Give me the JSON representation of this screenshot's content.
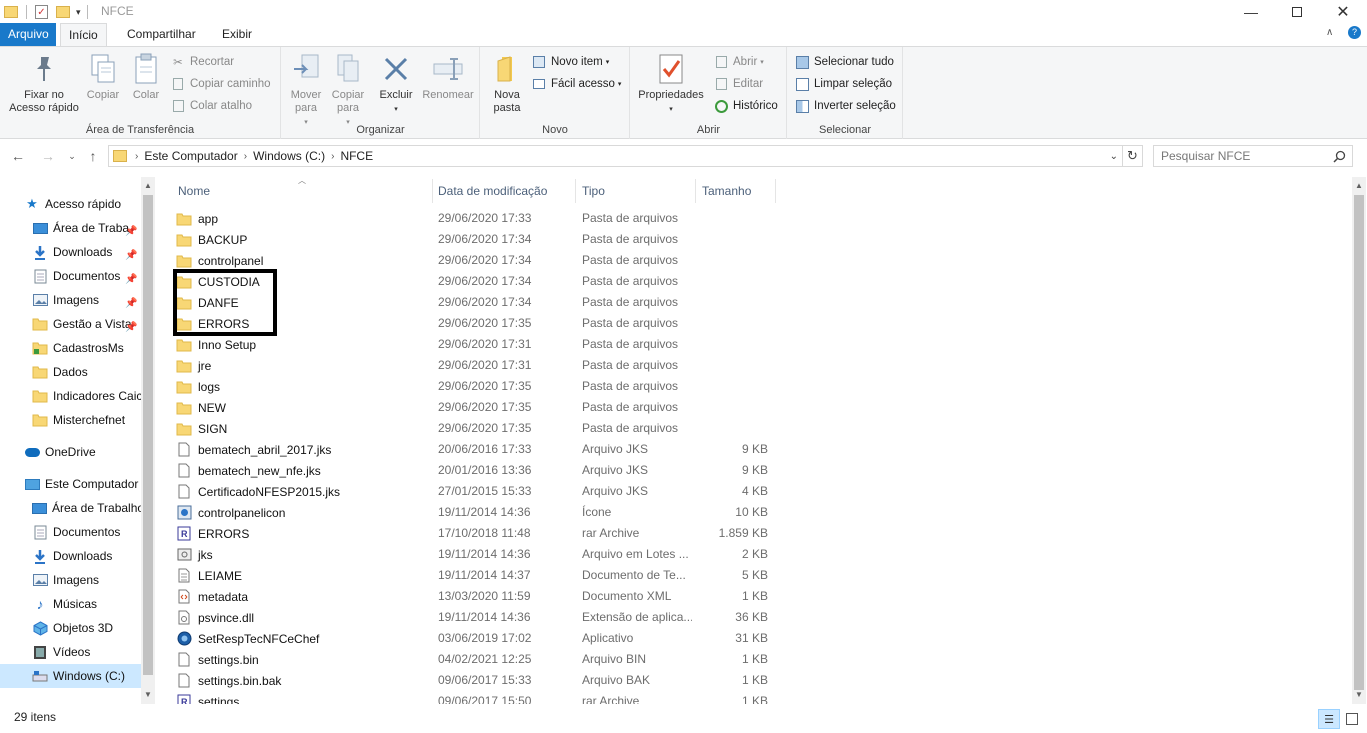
{
  "window": {
    "title": "NFCE"
  },
  "tabs": {
    "file": "Arquivo",
    "home": "Início",
    "share": "Compartilhar",
    "view": "Exibir"
  },
  "ribbon": {
    "clipboard": {
      "pin": "Fixar no Acesso rápido",
      "copy": "Copiar",
      "paste": "Colar",
      "cut": "Recortar",
      "copy_path": "Copiar caminho",
      "paste_shortcut": "Colar atalho",
      "label": "Área de Transferência"
    },
    "organize": {
      "move_to": "Mover para",
      "copy_to": "Copiar para",
      "delete": "Excluir",
      "rename": "Renomear",
      "label": "Organizar"
    },
    "new": {
      "new_folder": "Nova pasta",
      "new_item": "Novo item",
      "easy_access": "Fácil acesso",
      "label": "Novo"
    },
    "open": {
      "properties": "Propriedades",
      "open": "Abrir",
      "edit": "Editar",
      "history": "Histórico",
      "label": "Abrir"
    },
    "select": {
      "select_all": "Selecionar tudo",
      "select_none": "Limpar seleção",
      "invert": "Inverter seleção",
      "label": "Selecionar"
    }
  },
  "address": {
    "crumbs": [
      "Este Computador",
      "Windows (C:)",
      "NFCE"
    ],
    "search_placeholder": "Pesquisar NFCE"
  },
  "nav": {
    "quick_access": "Acesso rápido",
    "items": [
      {
        "label": "Área de Traba",
        "icon": "desktop-icon",
        "pinned": true
      },
      {
        "label": "Downloads",
        "icon": "download-icon",
        "pinned": true
      },
      {
        "label": "Documentos",
        "icon": "documents-icon",
        "pinned": true
      },
      {
        "label": "Imagens",
        "icon": "pictures-icon",
        "pinned": true
      },
      {
        "label": "Gestão a Vista",
        "icon": "folder-icon",
        "pinned": true
      },
      {
        "label": "CadastrosMs",
        "icon": "folder-green-icon",
        "pinned": false
      },
      {
        "label": "Dados",
        "icon": "folder-icon",
        "pinned": false
      },
      {
        "label": "Indicadores Caic",
        "icon": "folder-icon",
        "pinned": false
      },
      {
        "label": "Misterchefnet",
        "icon": "folder-icon",
        "pinned": false
      }
    ],
    "onedrive": "OneDrive",
    "this_pc": "Este Computador",
    "pc_items": [
      {
        "label": "Área de Trabalho",
        "icon": "desktop-icon"
      },
      {
        "label": "Documentos",
        "icon": "documents-icon"
      },
      {
        "label": "Downloads",
        "icon": "download-icon"
      },
      {
        "label": "Imagens",
        "icon": "pictures-icon"
      },
      {
        "label": "Músicas",
        "icon": "music-icon"
      },
      {
        "label": "Objetos 3D",
        "icon": "3d-objects-icon"
      },
      {
        "label": "Vídeos",
        "icon": "videos-icon"
      },
      {
        "label": "Windows (C:)",
        "icon": "drive-icon"
      }
    ]
  },
  "columns": {
    "name": "Nome",
    "date": "Data de modificação",
    "type": "Tipo",
    "size": "Tamanho"
  },
  "files": [
    {
      "name": "app",
      "date": "29/06/2020 17:33",
      "type": "Pasta de arquivos",
      "size": "",
      "icon": "folder-icon"
    },
    {
      "name": "BACKUP",
      "date": "29/06/2020 17:34",
      "type": "Pasta de arquivos",
      "size": "",
      "icon": "folder-icon"
    },
    {
      "name": "controlpanel",
      "date": "29/06/2020 17:34",
      "type": "Pasta de arquivos",
      "size": "",
      "icon": "folder-icon"
    },
    {
      "name": "CUSTODIA",
      "date": "29/06/2020 17:34",
      "type": "Pasta de arquivos",
      "size": "",
      "icon": "folder-icon"
    },
    {
      "name": "DANFE",
      "date": "29/06/2020 17:34",
      "type": "Pasta de arquivos",
      "size": "",
      "icon": "folder-icon"
    },
    {
      "name": "ERRORS",
      "date": "29/06/2020 17:35",
      "type": "Pasta de arquivos",
      "size": "",
      "icon": "folder-icon"
    },
    {
      "name": "Inno Setup",
      "date": "29/06/2020 17:31",
      "type": "Pasta de arquivos",
      "size": "",
      "icon": "folder-icon"
    },
    {
      "name": "jre",
      "date": "29/06/2020 17:31",
      "type": "Pasta de arquivos",
      "size": "",
      "icon": "folder-icon"
    },
    {
      "name": "logs",
      "date": "29/06/2020 17:35",
      "type": "Pasta de arquivos",
      "size": "",
      "icon": "folder-icon"
    },
    {
      "name": "NEW",
      "date": "29/06/2020 17:35",
      "type": "Pasta de arquivos",
      "size": "",
      "icon": "folder-icon"
    },
    {
      "name": "SIGN",
      "date": "29/06/2020 17:35",
      "type": "Pasta de arquivos",
      "size": "",
      "icon": "folder-icon"
    },
    {
      "name": "bematech_abril_2017.jks",
      "date": "20/06/2016 17:33",
      "type": "Arquivo JKS",
      "size": "9 KB",
      "icon": "file-icon"
    },
    {
      "name": "bematech_new_nfe.jks",
      "date": "20/01/2016 13:36",
      "type": "Arquivo JKS",
      "size": "9 KB",
      "icon": "file-icon"
    },
    {
      "name": "CertificadoNFESP2015.jks",
      "date": "27/01/2015 15:33",
      "type": "Arquivo JKS",
      "size": "4 KB",
      "icon": "file-icon"
    },
    {
      "name": "controlpanelicon",
      "date": "19/11/2014 14:36",
      "type": "Ícone",
      "size": "10 KB",
      "icon": "icon-file-icon"
    },
    {
      "name": "ERRORS",
      "date": "17/10/2018 11:48",
      "type": "rar Archive",
      "size": "1.859 KB",
      "icon": "rar-icon"
    },
    {
      "name": "jks",
      "date": "19/11/2014 14:36",
      "type": "Arquivo em Lotes ...",
      "size": "2 KB",
      "icon": "batch-icon"
    },
    {
      "name": "LEIAME",
      "date": "19/11/2014 14:37",
      "type": "Documento de Te...",
      "size": "5 KB",
      "icon": "text-file-icon"
    },
    {
      "name": "metadata",
      "date": "13/03/2020 11:59",
      "type": "Documento XML",
      "size": "1 KB",
      "icon": "xml-icon"
    },
    {
      "name": "psvince.dll",
      "date": "19/11/2014 14:36",
      "type": "Extensão de aplica...",
      "size": "36 KB",
      "icon": "dll-icon"
    },
    {
      "name": "SetRespTecNFCeChef",
      "date": "03/06/2019 17:02",
      "type": "Aplicativo",
      "size": "31 KB",
      "icon": "app-icon"
    },
    {
      "name": "settings.bin",
      "date": "04/02/2021 12:25",
      "type": "Arquivo BIN",
      "size": "1 KB",
      "icon": "file-icon"
    },
    {
      "name": "settings.bin.bak",
      "date": "09/06/2017 15:33",
      "type": "Arquivo BAK",
      "size": "1 KB",
      "icon": "file-icon"
    },
    {
      "name": "settings",
      "date": "09/06/2017 15:50",
      "type": "rar Archive",
      "size": "1 KB",
      "icon": "rar-icon"
    }
  ],
  "status": {
    "count": "29 itens"
  },
  "colors": {
    "accent": "#1979ca",
    "folder": "#f8d775",
    "selected": "#cce8ff"
  }
}
